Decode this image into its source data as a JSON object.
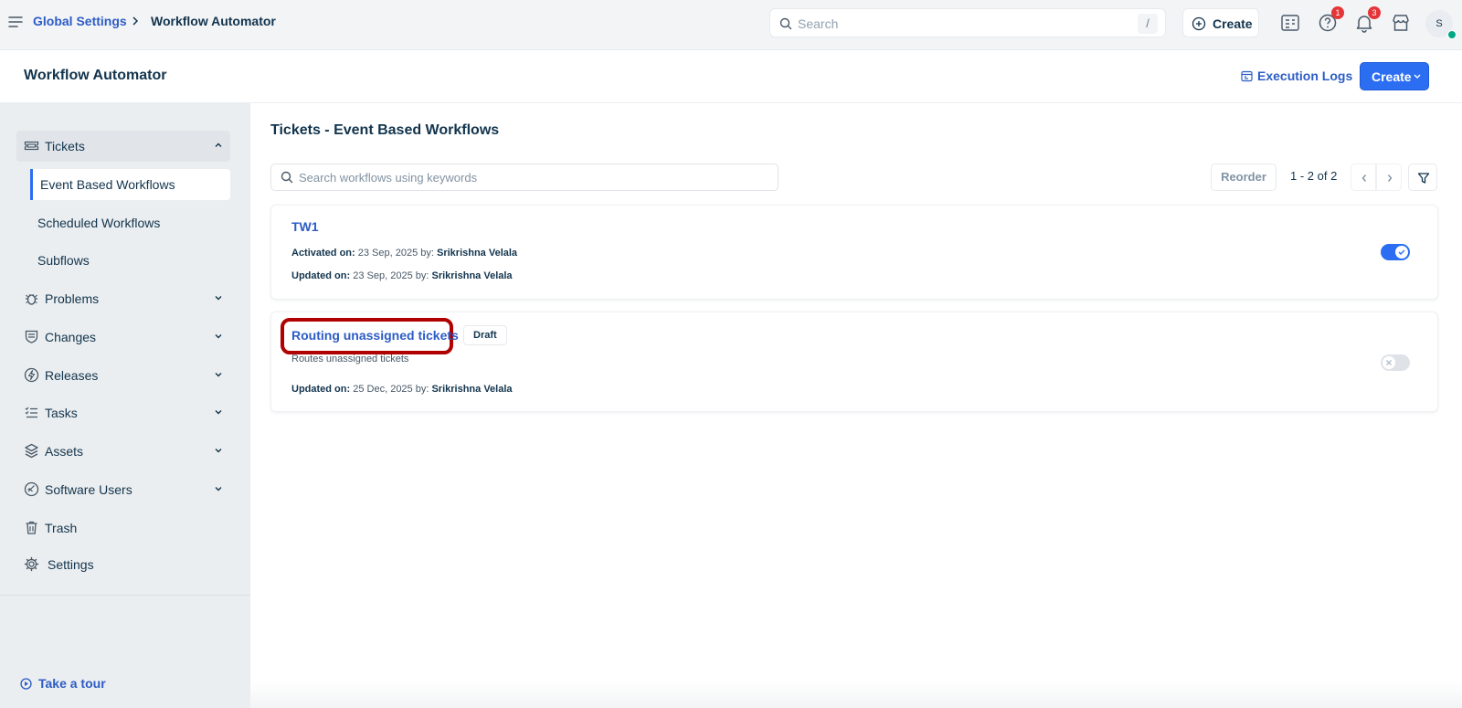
{
  "topbar": {
    "breadcrumb_root": "Global Settings",
    "breadcrumb_current": "Workflow Automator",
    "search_placeholder": "Search",
    "search_shortcut": "/",
    "create_label": "Create",
    "help_badge": "1",
    "notifications_badge": "3",
    "avatar_initial": "S"
  },
  "header": {
    "title": "Workflow Automator",
    "execution_logs_label": "Execution Logs",
    "create_label": "Create"
  },
  "sidebar": {
    "tickets_label": "Tickets",
    "tickets_children": [
      {
        "label": "Event Based Workflows",
        "active": true
      },
      {
        "label": "Scheduled Workflows",
        "active": false
      },
      {
        "label": "Subflows",
        "active": false
      }
    ],
    "items": [
      {
        "label": "Problems",
        "icon": "bug-icon"
      },
      {
        "label": "Changes",
        "icon": "changes-shield-icon"
      },
      {
        "label": "Releases",
        "icon": "releases-bolt-icon"
      },
      {
        "label": "Tasks",
        "icon": "tasks-list-icon"
      },
      {
        "label": "Assets",
        "icon": "layers-icon"
      },
      {
        "label": "Software Users",
        "icon": "software-icon"
      },
      {
        "label": "Trash",
        "icon": "trash-icon"
      },
      {
        "label": "Settings",
        "icon": "gear-icon"
      }
    ],
    "tour_label": "Take a tour"
  },
  "main": {
    "title": "Tickets - Event Based Workflows",
    "search_placeholder": "Search workflows using keywords",
    "reorder_label": "Reorder",
    "pagination": "1 - 2 of 2",
    "workflows": [
      {
        "name": "TW1",
        "activated_label": "Activated on:",
        "activated_value": "23 Sep, 2025 by:",
        "activated_by": "Srikrishna Velala",
        "updated_label": "Updated on:",
        "updated_value": "23 Sep, 2025 by:",
        "updated_by": "Srikrishna Velala",
        "enabled": true
      },
      {
        "name": "Routing unassigned tickets",
        "tag": "Draft",
        "description": "Routes unassigned tickets",
        "updated_label": "Updated on:",
        "updated_value": "25 Dec, 2025 by:",
        "updated_by": "Srikrishna Velala",
        "enabled": false
      }
    ]
  },
  "colors": {
    "accent": "#2c6ef2",
    "link": "#2c5cc5",
    "text": "#12344d",
    "badge": "#e43538",
    "highlight": "#b00000"
  }
}
